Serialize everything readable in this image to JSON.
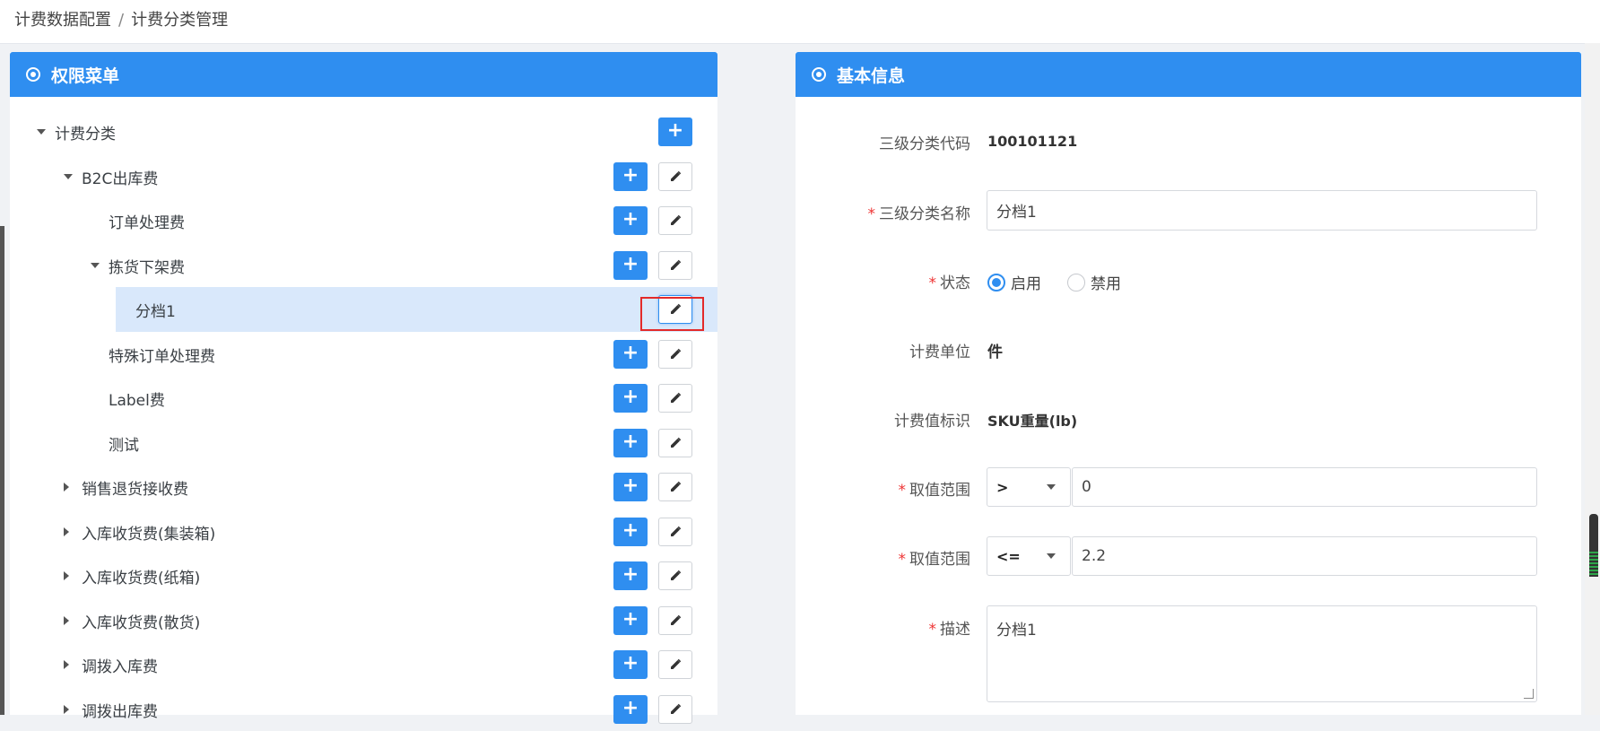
{
  "breadcrumb": {
    "items": [
      "计费数据配置",
      "/",
      "计费分类管理"
    ]
  },
  "left_panel": {
    "title": "权限菜单",
    "tree": [
      {
        "label": "计费分类",
        "level": 0,
        "expanded": true,
        "has_add": true,
        "has_edit": false
      },
      {
        "label": "B2C出库费",
        "level": 1,
        "expanded": true,
        "has_add": true,
        "has_edit": true
      },
      {
        "label": "订单处理费",
        "level": 2,
        "expanded": null,
        "has_add": true,
        "has_edit": true
      },
      {
        "label": "拣货下架费",
        "level": 2,
        "expanded": true,
        "has_add": true,
        "has_edit": true
      },
      {
        "label": "分档1",
        "level": 3,
        "expanded": null,
        "has_add": false,
        "has_edit": true,
        "selected": true
      },
      {
        "label": "特殊订单处理费",
        "level": 2,
        "expanded": null,
        "has_add": true,
        "has_edit": true
      },
      {
        "label": "Label费",
        "level": 2,
        "expanded": null,
        "has_add": true,
        "has_edit": true
      },
      {
        "label": "测试",
        "level": 2,
        "expanded": null,
        "has_add": true,
        "has_edit": true
      },
      {
        "label": "销售退货接收费",
        "level": 1,
        "expanded": false,
        "has_add": true,
        "has_edit": true
      },
      {
        "label": "入库收货费(集装箱)",
        "level": 1,
        "expanded": false,
        "has_add": true,
        "has_edit": true
      },
      {
        "label": "入库收货费(纸箱)",
        "level": 1,
        "expanded": false,
        "has_add": true,
        "has_edit": true
      },
      {
        "label": "入库收货费(散货)",
        "level": 1,
        "expanded": false,
        "has_add": true,
        "has_edit": true
      },
      {
        "label": "调拨入库费",
        "level": 1,
        "expanded": false,
        "has_add": true,
        "has_edit": true
      },
      {
        "label": "调拨出库费",
        "level": 1,
        "expanded": false,
        "has_add": true,
        "has_edit": true
      }
    ],
    "add_glyph": "+"
  },
  "right_panel": {
    "title": "基本信息",
    "fields": {
      "code_label": "三级分类代码",
      "code_value": "100101121",
      "name_label": "三级分类名称",
      "name_value": "分档1",
      "status_label": "状态",
      "status_options": [
        "启用",
        "禁用"
      ],
      "status_selected": "启用",
      "unit_label": "计费单位",
      "unit_value": "件",
      "flag_label": "计费值标识",
      "flag_value": "SKU重量(lb)",
      "range1_label": "取值范围",
      "range1_op": ">",
      "range1_value": "0",
      "range2_label": "取值范围",
      "range2_op": "<=",
      "range2_value": "2.2",
      "desc_label": "描述",
      "desc_value": "分档1"
    },
    "required_mark": "*"
  },
  "colors": {
    "primary": "#2f8ef0",
    "selected_row": "#d9e8fb",
    "highlight_box": "#e32a2a",
    "required": "#e33333"
  }
}
